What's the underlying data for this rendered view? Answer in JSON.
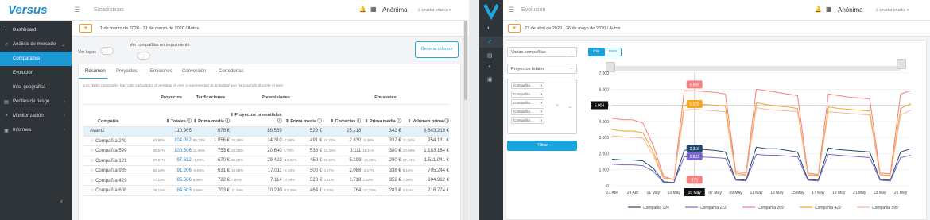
{
  "left": {
    "logo": "Versus",
    "page_title": "Estadísticas",
    "company_name": "Anónima",
    "user_label": "prueba prueba",
    "sidebar": [
      {
        "icon": "dashboard-icon",
        "label": "Dashboard"
      },
      {
        "icon": "chart-icon",
        "label": "Análisis de mercado"
      },
      {
        "icon": "",
        "label": "Comparativa"
      },
      {
        "icon": "",
        "label": "Evolución"
      },
      {
        "icon": "",
        "label": "Info. geográfica"
      },
      {
        "icon": "risk-icon",
        "label": "Perfiles de riesgo"
      },
      {
        "icon": "monitor-icon",
        "label": "Monitorización"
      },
      {
        "icon": "report-icon",
        "label": "Informes"
      }
    ],
    "date_range": "1 de marzo de 2020 - 31 de marzo de 2020 / Autos",
    "toggle1_label": "Ver logos",
    "toggle2_label": "Ver compañías en seguimiento",
    "generate_button": "Generar informe",
    "tabs": [
      "Resumen",
      "Proyectos",
      "Emisiones",
      "Conversión",
      "Corredurías"
    ],
    "note": "Los datos mostrados han sido calculados al terminar el mes y representan la actividad que ha ocurrido durante el mes",
    "group_headers": [
      "Proyectos",
      "Tarificaciones",
      "Preemisiones",
      "Emisiones"
    ],
    "col_headers": [
      "Compañía",
      "Totales",
      "Prima media",
      "Proyectos preemitidos",
      "Prima media",
      "Correctas",
      "Prima media",
      "Volumen prima"
    ],
    "avant_row": {
      "name": "Avant2",
      "cells": [
        "110.965",
        "678 €",
        "89.559",
        "529 €",
        "25.218",
        "342 €",
        "8.643.219 €"
      ]
    },
    "rows": [
      {
        "name": "Compañía 240",
        "cells": [
          [
            "93,80%",
            "104.082"
          ],
          [
            "55,73%",
            "1.056 €"
          ],
          [
            "15,98%",
            "14.310"
          ],
          [
            "-7,98%",
            "491 €"
          ],
          [
            "16,22%",
            "2.830"
          ],
          [
            "-3,48%",
            "337 €"
          ],
          [
            "11,04%",
            "954.131 €"
          ]
        ]
      },
      {
        "name": "Compañía 599",
        "cells": [
          [
            "90,57%",
            "100.506"
          ],
          [
            "11,06%",
            "753 €"
          ],
          [
            "23,05%",
            "20.640"
          ],
          [
            "1,70%",
            "538 €"
          ],
          [
            "12,34%",
            "3.111"
          ],
          [
            "11,11%",
            "380 €"
          ],
          [
            "13,69%",
            "1.183.184 €"
          ]
        ]
      },
      {
        "name": "Compañía 121",
        "cells": [
          [
            "87,97%",
            "97.612"
          ],
          [
            "-1,98%",
            "670 €"
          ],
          [
            "32,85%",
            "29.423"
          ],
          [
            "-14,93%",
            "450 €"
          ],
          [
            "20,62%",
            "5.199"
          ],
          [
            "-15,20%",
            "290 €"
          ],
          [
            "17,48%",
            "1.511.041 €"
          ]
        ]
      },
      {
        "name": "Compañía 985",
        "cells": [
          [
            "82,19%",
            "91.206"
          ],
          [
            "-6,93%",
            "631 €"
          ],
          [
            "18,99%",
            "17.011"
          ],
          [
            "-5,46%",
            "500 €"
          ],
          [
            "8,27%",
            "2.086"
          ],
          [
            "-1,17%",
            "338 €"
          ],
          [
            "8,16%",
            "705.244 €"
          ]
        ]
      },
      {
        "name": "Compañía 429",
        "cells": [
          [
            "77,13%",
            "85.586"
          ],
          [
            "6,48%",
            "722 €"
          ],
          [
            "7,94%",
            "7.114"
          ],
          [
            "-0,19%",
            "528 €"
          ],
          [
            "6,81%",
            "1.718"
          ],
          [
            "2,92%",
            "352 €"
          ],
          [
            "7,00%",
            "604.912 €"
          ]
        ]
      },
      {
        "name": "Compañía 608",
        "cells": [
          [
            "76,15%",
            "84.503"
          ],
          [
            "3,69%",
            "703 €"
          ],
          [
            "11,49%",
            "10.290"
          ],
          [
            "-12,29%",
            "464 €"
          ],
          [
            "3,03%",
            "764"
          ],
          [
            "-17,23%",
            "283 €"
          ],
          [
            "2,51%",
            "216.774 €"
          ]
        ]
      }
    ]
  },
  "right": {
    "page_title": "Evolución",
    "company_name": "Anónima",
    "user_label": "prueba prueba",
    "date_range": "27 de abril de 2020 - 26 de mayo de 2020 / Autos",
    "select1": "Varias compañías",
    "select2": "Proyectos totales",
    "tags": [
      "Compañía ...",
      "Compañía ...",
      "Compañía ...",
      "Compañía ...",
      "Compañía ..."
    ],
    "filter_button": "Filtrar",
    "period_tabs": [
      "día",
      "mes"
    ],
    "tooltip_date": "05 May",
    "crosshair_value": "5.004",
    "markers": [
      {
        "value": "5.899",
        "series": "Compañía 269"
      },
      {
        "value": "5.076",
        "series": "Compañía 429"
      },
      {
        "value": "2.316",
        "series": "Compañía 124"
      },
      {
        "value": "1.823",
        "series": "Compañía 222"
      },
      {
        "value": "373",
        "series": "Compañía 269"
      }
    ]
  },
  "chart_data": {
    "type": "line",
    "ylim": [
      0,
      7000
    ],
    "y_ticks": [
      "0",
      "1.000",
      "2.000",
      "3.000",
      "4.000",
      "5.000",
      "6.000",
      "7.000"
    ],
    "x_ticks": [
      "27 Abr",
      "29 Abr",
      "01 May",
      "03 May",
      "05 May",
      "07 May",
      "09 May",
      "11 May",
      "13 May",
      "15 May",
      "17 May",
      "19 May",
      "21 May",
      "23 May",
      "25 May",
      "27 Ma"
    ],
    "x": [
      "27 Abr",
      "28 Abr",
      "29 Abr",
      "30 Abr",
      "01 May",
      "02 May",
      "03 May",
      "04 May",
      "05 May",
      "06 May",
      "07 May",
      "08 May",
      "09 May",
      "10 May",
      "11 May",
      "12 May",
      "13 May",
      "14 May",
      "15 May",
      "16 May",
      "17 May",
      "18 May",
      "19 May",
      "20 May",
      "21 May",
      "22 May",
      "23 May",
      "24 May",
      "25 May",
      "26 May"
    ],
    "series": [
      {
        "name": "Compañía 124",
        "color": "#24476b",
        "values": [
          1650,
          1600,
          1600,
          1550,
          1100,
          250,
          200,
          2200,
          2316,
          2250,
          2200,
          2100,
          400,
          350,
          2400,
          2300,
          2300,
          2200,
          2100,
          400,
          350,
          2350,
          2250,
          2200,
          2150,
          2100,
          400,
          350,
          2100,
          2300
        ]
      },
      {
        "name": "Compañía 222",
        "color": "#7b68c8",
        "values": [
          1350,
          1300,
          1300,
          1250,
          900,
          200,
          180,
          1800,
          1823,
          1780,
          1750,
          1700,
          350,
          300,
          1950,
          1900,
          1900,
          1850,
          1800,
          350,
          300,
          1950,
          1900,
          1850,
          1800,
          1750,
          350,
          300,
          1750,
          1900
        ]
      },
      {
        "name": "Compañía 269",
        "color": "#f48080",
        "values": [
          4200,
          4100,
          4100,
          3900,
          2500,
          600,
          373,
          5900,
          5899,
          5850,
          5800,
          5700,
          900,
          800,
          6000,
          5900,
          5800,
          5700,
          5600,
          800,
          700,
          5700,
          5600,
          5500,
          5450,
          5400,
          800,
          750,
          5700,
          5900
        ]
      },
      {
        "name": "Compañía 429",
        "color": "#f5a623",
        "values": [
          3500,
          3400,
          3400,
          3300,
          2100,
          500,
          400,
          5000,
          5076,
          5050,
          5000,
          4950,
          800,
          700,
          5150,
          5050,
          4950,
          4900,
          4800,
          700,
          650,
          4900,
          4800,
          4750,
          4700,
          4650,
          700,
          650,
          4800,
          5100
        ]
      },
      {
        "name": "Compañía 599",
        "color": "#f7b898",
        "values": [
          3100,
          3050,
          3000,
          2950,
          1900,
          450,
          400,
          4700,
          4750,
          4700,
          4650,
          4600,
          700,
          650,
          4850,
          4750,
          4700,
          4650,
          4600,
          650,
          600,
          4600,
          4550,
          4500,
          4450,
          4400,
          650,
          600,
          4400,
          4700
        ]
      }
    ]
  }
}
